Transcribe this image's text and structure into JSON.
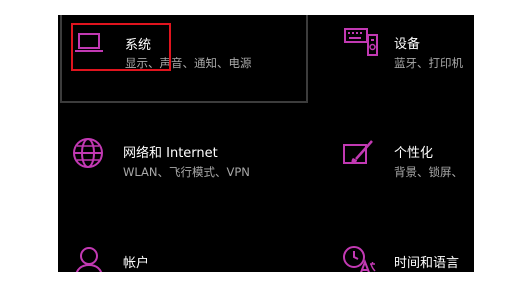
{
  "settings": {
    "accent_color": "#c239b3",
    "tiles": [
      {
        "title": "系统",
        "description": "显示、声音、通知、电源",
        "icon": "laptop-icon"
      },
      {
        "title": "设备",
        "description": "蓝牙、打印机",
        "icon": "keyboard-device-icon"
      },
      {
        "title": "网络和 Internet",
        "description": "WLAN、飞行模式、VPN",
        "icon": "globe-icon"
      },
      {
        "title": "个性化",
        "description": "背景、锁屏、",
        "icon": "paint-brush-icon"
      },
      {
        "title": "帐户",
        "description": "",
        "icon": "person-icon"
      },
      {
        "title": "时间和语言",
        "description": "",
        "icon": "time-language-icon"
      }
    ]
  }
}
